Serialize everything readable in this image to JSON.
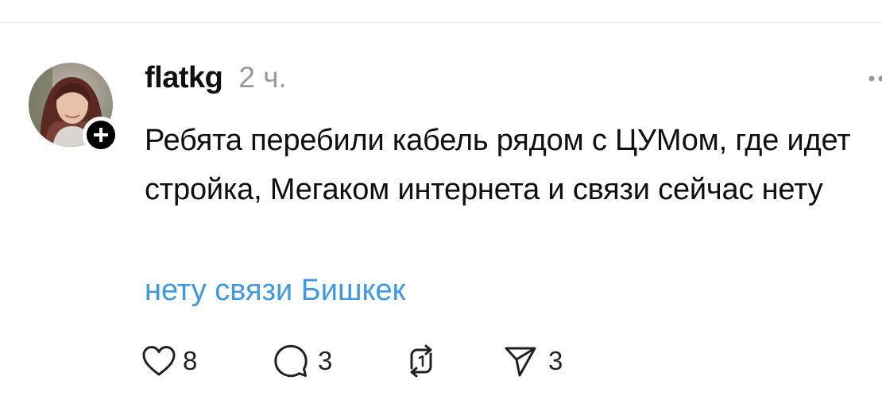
{
  "post": {
    "username": "flatkg",
    "time": "2 ч.",
    "text": "Ребята перебили кабель рядом с ЦУМом, где идет стройка, Мегаком интернета и связи сейчас нету",
    "tag": "нету связи Бишкек"
  },
  "actions": {
    "like": {
      "icon": "heart-icon",
      "count": "8"
    },
    "comment": {
      "icon": "comment-icon",
      "count": "3"
    },
    "repost": {
      "icon": "repost-icon"
    },
    "share": {
      "icon": "send-icon",
      "count": "3"
    }
  },
  "colors": {
    "tag": "#3d98e5",
    "time": "#9a9a9a",
    "text": "#101010",
    "badge": "#000000"
  }
}
